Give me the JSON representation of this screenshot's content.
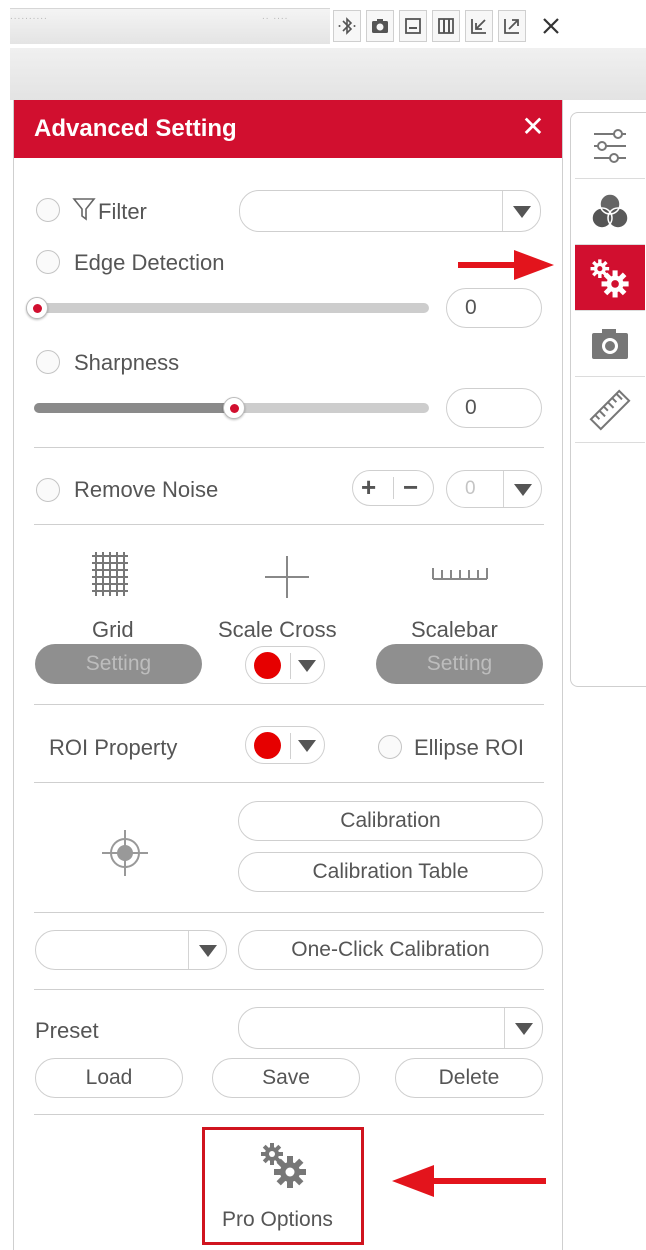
{
  "toolbar": {
    "icons": [
      "bluetooth-icon",
      "camera-icon",
      "minimize-icon",
      "split-view-icon",
      "dock-icon",
      "undock-icon",
      "close-icon"
    ]
  },
  "panel": {
    "title": "Advanced Setting",
    "filter": {
      "label": "Filter",
      "value": ""
    },
    "edge_detection": {
      "label": "Edge Detection",
      "value": "0",
      "level": 0
    },
    "sharpness": {
      "label": "Sharpness",
      "value": "0",
      "level": 0.5
    },
    "remove_noise": {
      "label": "Remove Noise",
      "plus": "+",
      "minus": "−",
      "value": "0"
    },
    "grid": {
      "label": "Grid",
      "button": "Setting"
    },
    "scale_cross": {
      "label": "Scale Cross",
      "color": "#e60000"
    },
    "scalebar": {
      "label": "Scalebar",
      "button": "Setting"
    },
    "roi": {
      "label": "ROI Property",
      "color": "#e60000",
      "ellipse_label": "Ellipse ROI"
    },
    "calibration": {
      "button": "Calibration",
      "table_button": "Calibration Table"
    },
    "one_click": {
      "select_value": "",
      "button": "One-Click Calibration"
    },
    "preset": {
      "label": "Preset",
      "value": "",
      "load": "Load",
      "save": "Save",
      "delete": "Delete"
    },
    "pro_options": {
      "label": "Pro Options"
    }
  },
  "sidebar": {
    "tabs": [
      {
        "name": "adjustments",
        "icon": "sliders-icon",
        "active": false
      },
      {
        "name": "color",
        "icon": "color-circles-icon",
        "active": false
      },
      {
        "name": "advanced-setting",
        "icon": "gears-icon",
        "active": true
      },
      {
        "name": "capture",
        "icon": "camera-icon",
        "active": false
      },
      {
        "name": "measure",
        "icon": "ruler-icon",
        "active": false
      }
    ]
  },
  "colors": {
    "accent": "#d10f2f",
    "marker": "#e60000",
    "annotation": "#d0141f"
  }
}
